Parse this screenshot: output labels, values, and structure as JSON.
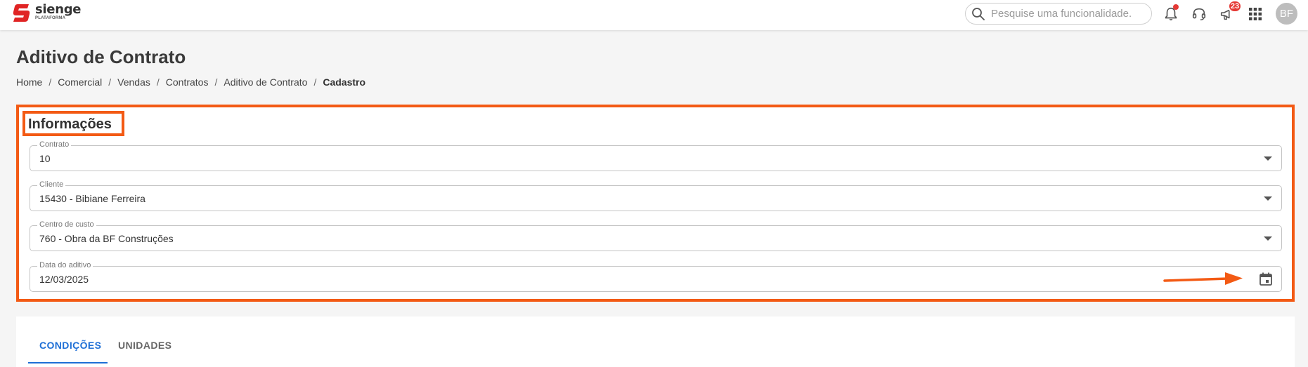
{
  "app": {
    "logo_name": "sienge",
    "logo_sub": "PLATAFORMA"
  },
  "search": {
    "placeholder": "Pesquise uma funcionalidade."
  },
  "header_icons": {
    "notifications_icon": "bell-icon",
    "support_icon": "headset-icon",
    "announcements_icon": "megaphone-icon",
    "announcements_badge": "23",
    "apps_icon": "grid-icon"
  },
  "user": {
    "initials": "BF"
  },
  "page": {
    "title": "Aditivo de Contrato",
    "breadcrumb": [
      "Home",
      "Comercial",
      "Vendas",
      "Contratos",
      "Aditivo de Contrato",
      "Cadastro"
    ]
  },
  "info": {
    "title": "Informações",
    "fields": [
      {
        "label": "Contrato",
        "value": "10"
      },
      {
        "label": "Cliente",
        "value": "15430 - Bibiane Ferreira"
      },
      {
        "label": "Centro de custo",
        "value": "760 - Obra da BF Construções"
      },
      {
        "label": "Data do aditivo",
        "value": "12/03/2025"
      }
    ]
  },
  "tabs": [
    {
      "label": "CONDIÇÕES",
      "active": true
    },
    {
      "label": "UNIDADES",
      "active": false
    }
  ],
  "colors": {
    "highlight": "#f35a14",
    "accent": "#1e6fd6",
    "brand": "#e02424",
    "badge": "#e53935"
  }
}
